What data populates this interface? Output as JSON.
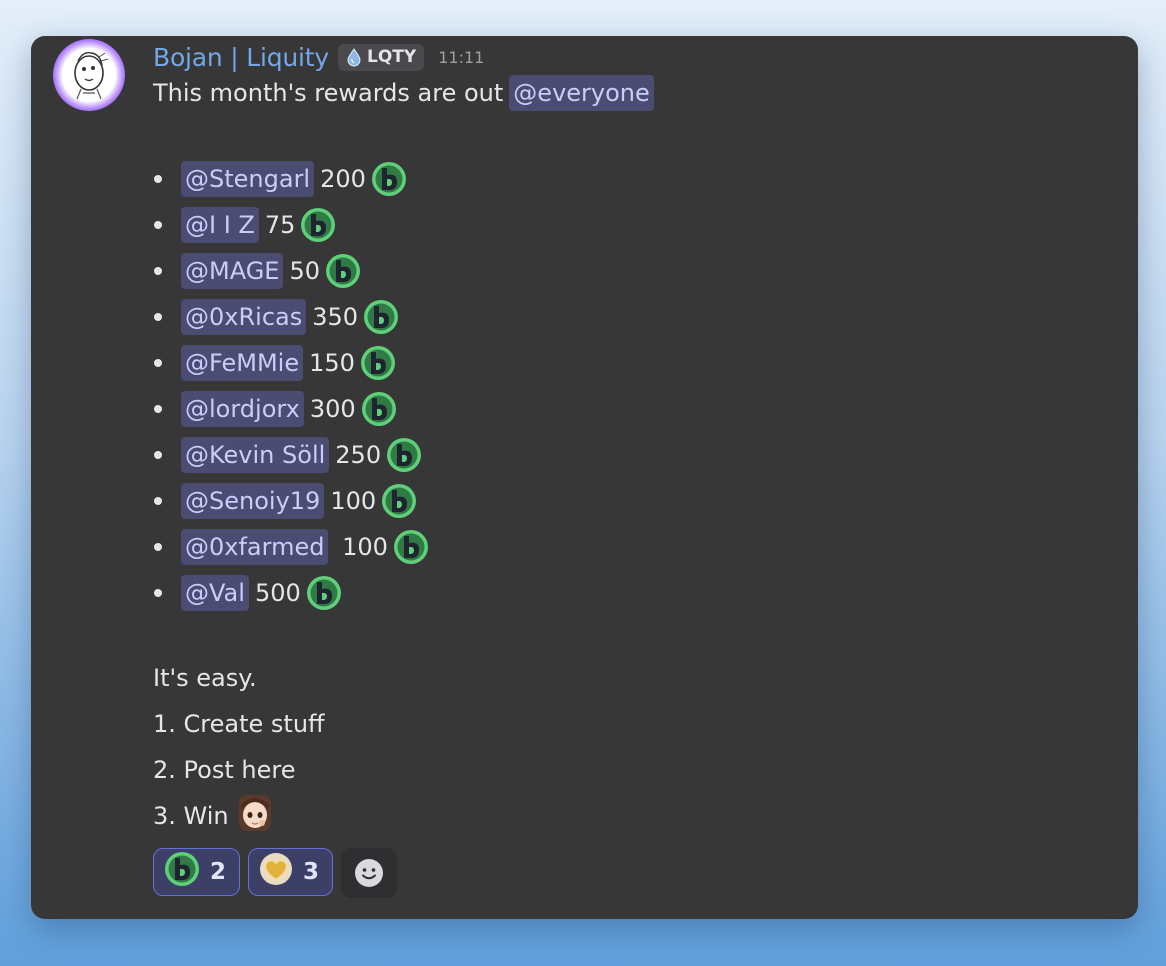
{
  "message": {
    "author": "Bojan | Liquity",
    "role_badge": "LQTY",
    "timestamp": "11:11",
    "intro_text": "This month's rewards are out",
    "intro_mention": "@everyone",
    "rewards": [
      {
        "mention": "@Stengarl",
        "amount": "200"
      },
      {
        "mention": "@I I Z",
        "amount": "75"
      },
      {
        "mention": "@MAGE",
        "amount": "50"
      },
      {
        "mention": "@0xRicas",
        "amount": "350"
      },
      {
        "mention": "@FeMMie",
        "amount": "150"
      },
      {
        "mention": "@lordjorx",
        "amount": "300"
      },
      {
        "mention": "@Kevin Söll",
        "amount": "250"
      },
      {
        "mention": "@Senoiy19",
        "amount": "100"
      },
      {
        "mention": "@0xfarmed",
        "amount": " 100"
      },
      {
        "mention": "@Val",
        "amount": "500"
      }
    ],
    "steps_intro": "It's easy.",
    "steps": [
      "1. Create stuff",
      "2. Post here",
      "3. Win"
    ]
  },
  "reactions": [
    {
      "emoji": "bold-coin-emoji",
      "count": "2"
    },
    {
      "emoji": "gold-heart-emoji",
      "count": "3"
    }
  ],
  "colors": {
    "card_bg": "#373737",
    "author": "#74a7e8",
    "mention_bg": "#4a4c72",
    "mention_text": "#c9cdfb",
    "coin_green": "#5fcf7a",
    "reaction_border": "#6670d8"
  }
}
